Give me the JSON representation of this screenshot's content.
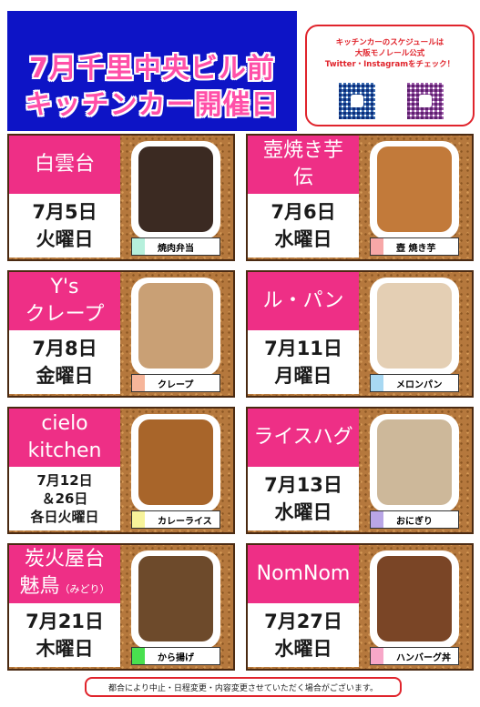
{
  "header": {
    "line1": "7月千里中央ビル前",
    "line2": "キッチンカー開催日"
  },
  "notice": {
    "line1": "キッチンカーのスケジュールは",
    "line2": "大阪モノレール公式",
    "line3": "Twitter・Instagramをチェック！"
  },
  "cards": [
    {
      "name": "白雲台",
      "date1": "7月5日",
      "date2": "火曜日",
      "item": "焼肉弁当",
      "swatch": "#b6f0dc",
      "photo": "#3b2a22"
    },
    {
      "name1": "壺焼き芋",
      "name2": "伝",
      "date1": "7月6日",
      "date2": "水曜日",
      "item": "壺 焼き芋",
      "swatch": "#f7a7a7",
      "photo": "#c27a3a"
    },
    {
      "name1": "Y's",
      "name2": "クレープ",
      "date1": "7月8日",
      "date2": "金曜日",
      "item": "クレープ",
      "swatch": "#f6b59a",
      "photo": "#c9a075"
    },
    {
      "name": "ル・パン",
      "date1": "7月11日",
      "date2": "月曜日",
      "item": "メロンパン",
      "swatch": "#a8d8f2",
      "photo": "#e4cfb4"
    },
    {
      "name1": "cielo",
      "name2": "kitchen",
      "date1": "7月12日",
      "date2": "＆26日",
      "date3": "各日火曜日",
      "item": "カレーライス",
      "swatch": "#f7f39a",
      "photo": "#a8652a"
    },
    {
      "name": "ライスハグ",
      "date1": "7月13日",
      "date2": "水曜日",
      "item": "おにぎり",
      "swatch": "#b9a6e6",
      "photo": "#cdb89a"
    },
    {
      "name1": "炭火屋台",
      "name2": "魅鳥",
      "name2_small": "（みどり）",
      "date1": "7月21日",
      "date2": "木曜日",
      "item": "から揚げ",
      "swatch": "#49e04f",
      "photo": "#6d4a2b"
    },
    {
      "name": "NomNom",
      "date1": "7月27日",
      "date2": "水曜日",
      "item": "ハンバーグ丼",
      "swatch": "#f7a7c8",
      "photo": "#7a4526"
    }
  ],
  "footer": {
    "text": "都合により中止・日程変更・内容変更させていただく場合がございます。"
  }
}
